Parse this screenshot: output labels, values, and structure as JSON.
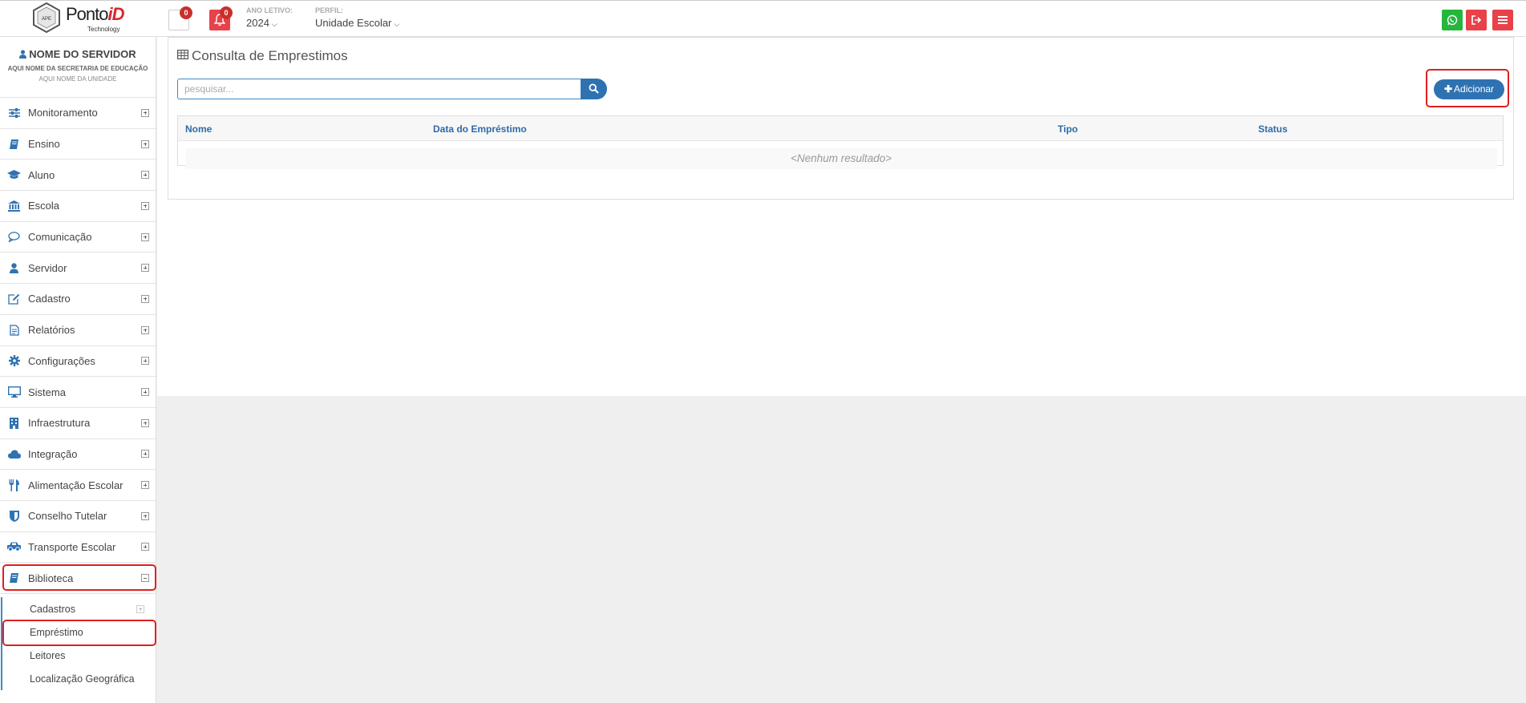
{
  "header": {
    "logo": {
      "brand_left": "Ponto",
      "brand_right": "iD",
      "tagline": "Technology",
      "badge": "APE"
    },
    "square_badge": "0",
    "bell_badge": "0",
    "year": {
      "label": "ANO LETIVO:",
      "value": "2024"
    },
    "profile": {
      "label": "PERFIL:",
      "value": "Unidade Escolar"
    },
    "colors": {
      "whatsapp": "#25b63c",
      "logout": "#e8414a",
      "menu": "#e8414a"
    }
  },
  "user": {
    "name": "NOME DO SERVIDOR",
    "secretaria": "AQUI NOME DA SECRETARIA DE EDUCAÇÃO",
    "unidade": "AQUI NOME DA UNIDADE"
  },
  "sidebar": {
    "items": [
      {
        "label": "Monitoramento",
        "icon": "sliders-icon"
      },
      {
        "label": "Ensino",
        "icon": "book-icon"
      },
      {
        "label": "Aluno",
        "icon": "graduation-cap-icon"
      },
      {
        "label": "Escola",
        "icon": "bank-icon"
      },
      {
        "label": "Comunicação",
        "icon": "chat-icon"
      },
      {
        "label": "Servidor",
        "icon": "user-icon"
      },
      {
        "label": "Cadastro",
        "icon": "edit-icon"
      },
      {
        "label": "Relatórios",
        "icon": "file-icon"
      },
      {
        "label": "Configurações",
        "icon": "gear-icon"
      },
      {
        "label": "Sistema",
        "icon": "desktop-icon"
      },
      {
        "label": "Infraestrutura",
        "icon": "building-icon"
      },
      {
        "label": "Integração",
        "icon": "cloud-icon"
      },
      {
        "label": "Alimentação Escolar",
        "icon": "cutlery-icon"
      },
      {
        "label": "Conselho Tutelar",
        "icon": "shield-icon"
      },
      {
        "label": "Transporte Escolar",
        "icon": "car-icon"
      },
      {
        "label": "Biblioteca",
        "icon": "book-icon"
      }
    ],
    "sub_items": [
      {
        "label": "Cadastros"
      },
      {
        "label": "Empréstimo"
      },
      {
        "label": "Leitores"
      },
      {
        "label": "Localização Geográfica"
      }
    ]
  },
  "main": {
    "title": "Consulta de Emprestimos",
    "search": {
      "placeholder": "pesquisar...",
      "value": ""
    },
    "add_label": "Adicionar",
    "table": {
      "columns": [
        "Nome",
        "Data do Empréstimo",
        "Tipo",
        "Status"
      ],
      "empty_text": "<Nenhum resultado>"
    }
  }
}
